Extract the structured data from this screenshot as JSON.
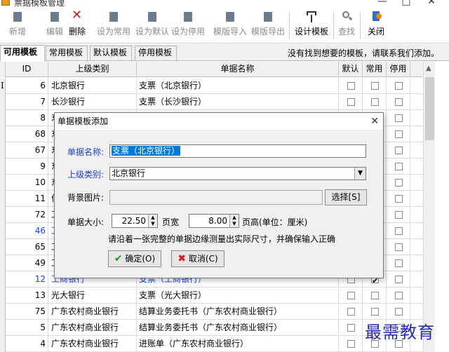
{
  "window": {
    "title": "票据模板管理",
    "minimize": "—",
    "maximize": "□",
    "close": "✕"
  },
  "toolbar": {
    "buttons": [
      {
        "label": "新增",
        "icon": "new-doc-icon",
        "enabled": false
      },
      {
        "label": "编辑",
        "icon": "edit-doc-icon",
        "enabled": false
      },
      {
        "label": "删除",
        "icon": "delete-x-icon",
        "enabled": true
      },
      {
        "label": "设为常用",
        "icon": "set-common-icon",
        "enabled": false
      },
      {
        "label": "设为默认",
        "icon": "set-default-icon",
        "enabled": false
      },
      {
        "label": "设为停用",
        "icon": "set-disabled-icon",
        "enabled": false
      },
      {
        "label": "模版导入",
        "icon": "import-icon",
        "enabled": false
      },
      {
        "label": "模版导出",
        "icon": "export-icon",
        "enabled": false
      },
      {
        "label": "设计模板",
        "icon": "design-icon",
        "enabled": true
      },
      {
        "label": "查找",
        "icon": "search-icon",
        "enabled": false
      },
      {
        "label": "关闭",
        "icon": "close-door-icon",
        "enabled": true
      }
    ]
  },
  "tabs": [
    {
      "label": "可用模板",
      "active": true
    },
    {
      "label": "常用模板",
      "active": false
    },
    {
      "label": "默认模板",
      "active": false
    },
    {
      "label": "停用模板",
      "active": false
    }
  ],
  "tab_note": "没有找到想要的模板，请联系我们添加。",
  "grid": {
    "columns": {
      "id": "ID",
      "parent": "上级类别",
      "name": "单据名称",
      "default": "默认",
      "common": "常用",
      "disabled": "停用"
    },
    "rows": [
      {
        "id": "6",
        "parent": "北京银行",
        "name": "支票（北京银行）",
        "default": false,
        "common": false,
        "disabled": false
      },
      {
        "id": "7",
        "parent": "长沙银行",
        "name": "支票（长沙银行）",
        "default": false,
        "common": false,
        "disabled": false
      },
      {
        "id": "8",
        "parent": "东",
        "name": "",
        "default": false,
        "common": false,
        "disabled": false
      },
      {
        "id": "68",
        "parent": "东",
        "name": "",
        "default": false,
        "common": false,
        "disabled": false
      },
      {
        "id": "67",
        "parent": "东",
        "name": "",
        "default": false,
        "common": false,
        "disabled": false
      },
      {
        "id": "9",
        "parent": "东",
        "name": "",
        "default": false,
        "common": false,
        "disabled": false
      },
      {
        "id": "10",
        "parent": "东",
        "name": "",
        "default": false,
        "common": false,
        "disabled": false
      },
      {
        "id": "11",
        "parent": "何",
        "name": "",
        "default": false,
        "common": false,
        "disabled": false
      },
      {
        "id": "72",
        "parent": "工",
        "name": "",
        "default": false,
        "common": false,
        "disabled": false
      },
      {
        "id": "46",
        "parent": "工",
        "name": "",
        "default": false,
        "common": false,
        "disabled": false,
        "blue": true
      },
      {
        "id": "65",
        "parent": "工",
        "name": "",
        "default": false,
        "common": false,
        "disabled": false
      },
      {
        "id": "49",
        "parent": "工",
        "name": "",
        "default": false,
        "common": false,
        "disabled": false
      },
      {
        "id": "12",
        "parent": "工商银行",
        "name": "支票（工商银行）",
        "default": false,
        "common": true,
        "disabled": false,
        "blue": true
      },
      {
        "id": "13",
        "parent": "光大银行",
        "name": "支票（光大银行）",
        "default": false,
        "common": false,
        "disabled": false
      },
      {
        "id": "75",
        "parent": "广东农村商业银行",
        "name": "结算业务委托书（广东农村商业银行）",
        "default": false,
        "common": false,
        "disabled": false
      },
      {
        "id": "5",
        "parent": "广东农村商业银行",
        "name": "结算业务委托书（广东农村商业银行）",
        "default": false,
        "common": false,
        "disabled": false
      },
      {
        "id": "4",
        "parent": "广东农村商业银行",
        "name": "进账单（广东农村商业银行）",
        "default": false,
        "common": false,
        "disabled": false
      }
    ]
  },
  "dialog": {
    "title": "单据模板添加",
    "close": "✕",
    "name_label": "单据名称:",
    "name_value": "支票（北京银行）",
    "parent_label": "上级类别:",
    "parent_value": "北京银行",
    "bg_label": "背景图片:",
    "bg_value": "",
    "select_button": "选择[S]",
    "size_label": "单据大小:",
    "width_value": "22.50",
    "width_unit": "页宽",
    "height_value": "8.00",
    "height_unit": "页高(单位：厘米)",
    "hint": "请沿着一张完整的单据边缘测量出实际尺寸，并确保输入正确",
    "ok_button": "确定(O)",
    "cancel_button": "取消(C)"
  },
  "watermark": "最需教育",
  "colors": {
    "selection": "#0078d7",
    "blue_label": "#1a3fd0",
    "delete_red": "#d21a1a",
    "ok_green": "#1a9a1a"
  }
}
